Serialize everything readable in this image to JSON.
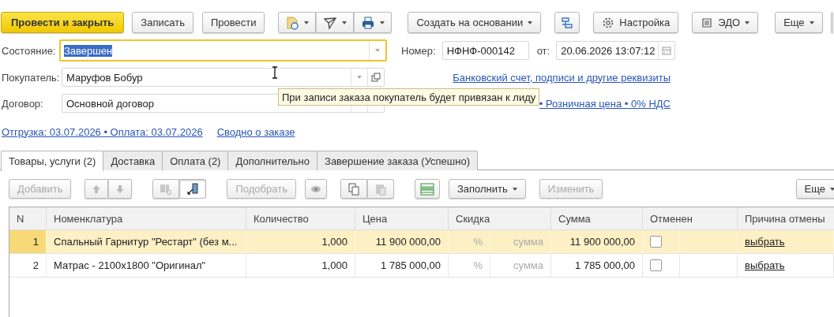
{
  "toolbar": {
    "post_and_close": "Провести и закрыть",
    "write": "Записать",
    "post": "Провести",
    "create_based_on": "Создать на основании",
    "settings": "Настройка",
    "edo": "ЭДО",
    "more": "Еще"
  },
  "form": {
    "status": {
      "label": "Состояние:",
      "value": "Завершен"
    },
    "number": {
      "label": "Номер:",
      "value": "НФНФ-000142"
    },
    "date": {
      "label": "от:",
      "value": "20.06.2026 13:07:12"
    },
    "buyer": {
      "label": "Покупатель:",
      "value": "Маруфов Бобур"
    },
    "contract": {
      "label": "Договор:",
      "value": "Основной договор"
    },
    "bank_link": "Банковский счет, подписи и другие реквизиты",
    "price_link": "• Розничная цена • 0% НДС",
    "tooltip": "При записи заказа покупатель будет привязан к лиду",
    "shipping_link": "Отгрузка: 03.07.2026 • Оплата: 03.07.2026",
    "summary_link": "Сводно о заказе"
  },
  "tabs": [
    {
      "label": "Товары, услуги (2)",
      "selected": true
    },
    {
      "label": "Доставка",
      "selected": false
    },
    {
      "label": "Оплата (2)",
      "selected": false
    },
    {
      "label": "Дополнительно",
      "selected": false
    },
    {
      "label": "Завершение заказа (Успешно)",
      "selected": false
    }
  ],
  "table_toolbar": {
    "add": {
      "label": "Добавить",
      "disabled": true
    },
    "pick": {
      "label": "Подобрать",
      "disabled": true
    },
    "fill": {
      "label": "Заполнить",
      "disabled": false
    },
    "change": {
      "label": "Изменить",
      "disabled": true
    },
    "more": {
      "label": "Еще",
      "disabled": false
    }
  },
  "table": {
    "columns": [
      "N",
      "Номенклатура",
      "Количество",
      "Цена",
      "Скидка",
      "Сумма",
      "Отменен",
      "Причина отмены"
    ],
    "rows": [
      {
        "n": "1",
        "name": "Спальный Гарнитур \"Рестарт\" (без м...",
        "quantity": "1,000",
        "price": "11 900 000,00",
        "discount_percent": "%",
        "discount_sum": "сумма",
        "sum": "11 900 000,00",
        "cancelled": false,
        "reason": "выбрать",
        "selected": true
      },
      {
        "n": "2",
        "name": "Матрас - 2100х1800 \"Оригинал\"",
        "quantity": "1,000",
        "price": "1 785 000,00",
        "discount_percent": "%",
        "discount_sum": "сумма",
        "sum": "1 785 000,00",
        "cancelled": false,
        "reason": "выбрать",
        "selected": false
      }
    ]
  }
}
